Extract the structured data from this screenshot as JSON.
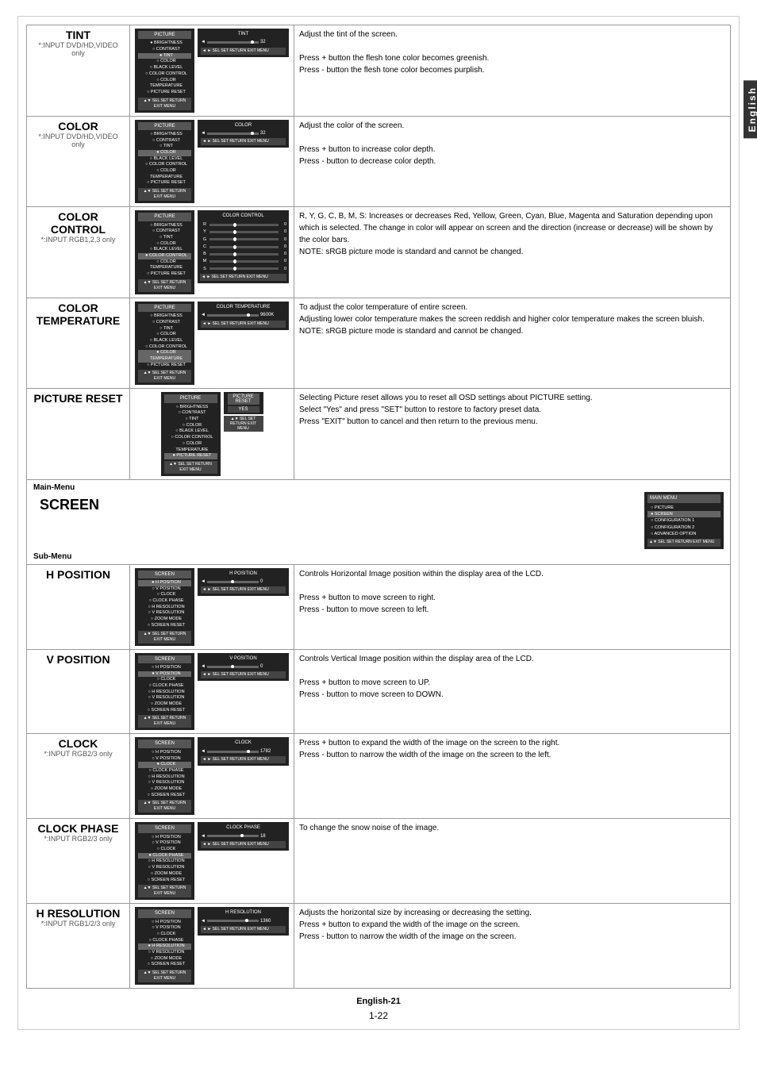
{
  "page": {
    "english_tab": "English",
    "bottom_label": "English-21",
    "page_number": "1-22"
  },
  "rows": [
    {
      "id": "tint",
      "name": "TINT",
      "sub_label": "*:INPUT DVD/HD,VIDEO only",
      "slider_value": "32",
      "description": "Adjust the tint of the screen.\n\nPress + button the flesh tone color becomes greenish.\nPress - button the flesh tone color becomes purplish."
    },
    {
      "id": "color",
      "name": "COLOR",
      "sub_label": "*:INPUT DVD/HD,VIDEO only",
      "slider_value": "32",
      "description": "Adjust the color of the screen.\n\nPress + button to increase color depth.\nPress - button to decrease color depth."
    },
    {
      "id": "color_control",
      "name": "COLOR CONTROL",
      "sub_label": "*:INPUT RGB1,2,3 only",
      "description": "R, Y, G, C, B, M, S: Increases or decreases Red, Yellow, Green, Cyan, Blue, Magenta and Saturation depending upon which is selected. The change in color will appear on screen and the direction (increase or decrease) will be shown by the color bars.\nNOTE: sRGB picture mode is standard and cannot be changed."
    },
    {
      "id": "color_temperature",
      "name": "COLOR\nTEMPERATURE",
      "sub_label": "",
      "slider_value": "9600K",
      "description": "To adjust the color temperature of entire screen.\nAdjusting lower color temperature makes the screen reddish and higher color temperature makes the screen bluish.\nNOTE: sRGB picture mode is standard and cannot be changed."
    },
    {
      "id": "picture_reset",
      "name": "PICTURE RESET",
      "sub_label": "",
      "description": "Selecting Picture reset allows you to reset all OSD settings about PICTURE setting.\nSelect \"Yes\" and press \"SET\" button to restore to factory preset data.\nPress \"EXIT\" button to cancel and then return to the previous menu."
    }
  ],
  "screen_section": {
    "main_menu_label": "Main-Menu",
    "main_menu_name": "SCREEN",
    "sub_menu_label": "Sub-Menu"
  },
  "screen_rows": [
    {
      "id": "h_position",
      "name": "H POSITION",
      "sub_label": "",
      "slider_value": "0",
      "description": "Controls Horizontal Image position within the display area of the LCD.\n\nPress + button to move screen to right.\nPress - button to move screen to left."
    },
    {
      "id": "v_position",
      "name": "V POSITION",
      "sub_label": "",
      "slider_value": "0",
      "description": "Controls Vertical Image position within the display area of the LCD.\n\nPress + button to move screen to UP.\nPress - button to move screen to DOWN."
    },
    {
      "id": "clock",
      "name": "CLOCK",
      "sub_label": "*:INPUT RGB2/3 only",
      "slider_value": "1782",
      "description": "Press + button to expand the width of the image on the screen to the right.\nPress - button to narrow the width of the image on the screen to the left."
    },
    {
      "id": "clock_phase",
      "name": "CLOCK PHASE",
      "sub_label": "*:INPUT RGB2/3 only",
      "slider_value": "18",
      "description": "To change the snow noise of the image."
    },
    {
      "id": "h_resolution",
      "name": "H RESOLUTION",
      "sub_label": "*:INPUT RGB1/2/3 only",
      "slider_value": "1360",
      "description": "Adjusts the horizontal size by increasing or decreasing the setting.\nPress + button to expand the width of the image on the screen.\nPress - button to narrow the width of the image on the screen."
    }
  ],
  "menu_items_picture": [
    "BRIGHTNESS",
    "CONTRAST",
    "TINT",
    "COLOR",
    "BLACK LEVEL",
    "COLOR CONTROL",
    "COLOR TEMPERATURE",
    "PICTURE RESET"
  ],
  "menu_items_screen": [
    "H POSITION",
    "V POSITION",
    "CLOCK",
    "CLOCK PHASE",
    "H RESOLUTION",
    "V RESOLUTION",
    "ZOOM MODE",
    "SCREEN RESET"
  ],
  "main_menu_items": [
    "PICTURE",
    "SCREEN",
    "CONFIGURATION 1",
    "CONFIGURATION 2",
    "ADVANCED OPTION"
  ]
}
